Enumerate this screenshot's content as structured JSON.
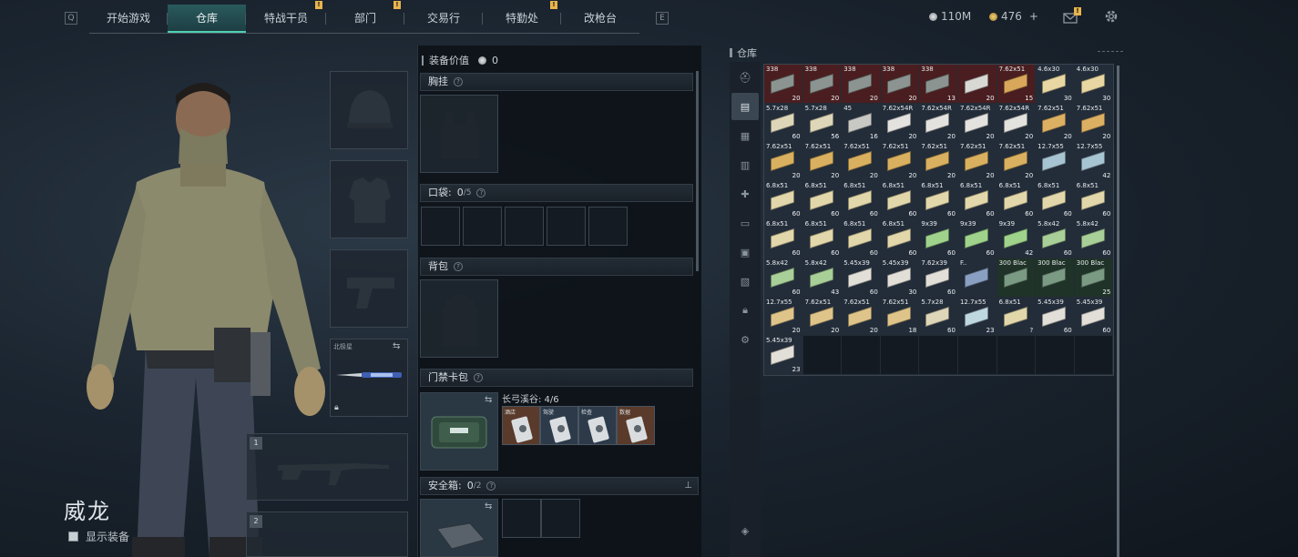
{
  "nav": {
    "left_key": "Q",
    "right_key": "E",
    "tabs": [
      {
        "label": "开始游戏",
        "badge": ""
      },
      {
        "label": "仓库",
        "badge": "",
        "active": true
      },
      {
        "label": "特战干员",
        "badge": "!"
      },
      {
        "label": "部门",
        "badge": "!"
      },
      {
        "label": "交易行",
        "badge": ""
      },
      {
        "label": "特勤处",
        "badge": "!"
      },
      {
        "label": "改枪台",
        "badge": ""
      }
    ],
    "silver": "110M",
    "gold": "476",
    "gold_plus": "+",
    "mail_badge": "!"
  },
  "character": {
    "name": "威龙",
    "show_equipment": "显示装备"
  },
  "slots": {
    "melee_label": "北极星",
    "weapon1_num": "1",
    "weapon2_num": "2"
  },
  "loadout": {
    "value_label": "装备价值",
    "value": "0",
    "chest_rig": "胸挂",
    "pockets_label": "口袋:",
    "pockets_used": "0",
    "pockets_total": "/5",
    "backpack": "背包",
    "keycard_label": "门禁卡包",
    "keycard_map": "长弓溪谷: 4/6",
    "keycards": [
      "酒店",
      "驾驶",
      "检查",
      "数据"
    ],
    "safebox_label": "安全箱:",
    "safebox_used": "0",
    "safebox_total": "/2"
  },
  "stash": {
    "title": "仓库",
    "items": [
      {
        "cal": "338",
        "n": "20",
        "c": "#8c9491",
        "bg": "red"
      },
      {
        "cal": "338",
        "n": "20",
        "c": "#8c9491",
        "bg": "red"
      },
      {
        "cal": "338",
        "n": "20",
        "c": "#8c9491",
        "bg": "red"
      },
      {
        "cal": "338",
        "n": "20",
        "c": "#8c9491",
        "bg": "red"
      },
      {
        "cal": "338",
        "n": "13",
        "c": "#8c9491",
        "bg": "red"
      },
      {
        "cal": "",
        "n": "20",
        "c": "#d8d8d4",
        "bg": "red"
      },
      {
        "cal": "7.62x51",
        "n": "15",
        "c": "#d9a75a",
        "bg": "red"
      },
      {
        "cal": "4.6x30",
        "n": "30",
        "c": "#e8d7a2",
        "bg": "it"
      },
      {
        "cal": "4.6x30",
        "n": "30",
        "c": "#e8d7a2",
        "bg": "it"
      },
      {
        "cal": "5.7x28",
        "n": "60",
        "c": "#ddd6b8",
        "bg": "it"
      },
      {
        "cal": "5.7x28",
        "n": "56",
        "c": "#ddd6b8",
        "bg": "it"
      },
      {
        "cal": "45",
        "n": "16",
        "c": "#c8c9c5",
        "bg": "it"
      },
      {
        "cal": "7.62x54R",
        "n": "20",
        "c": "#e3e2de",
        "bg": "it"
      },
      {
        "cal": "7.62x54R",
        "n": "20",
        "c": "#e3e2de",
        "bg": "it"
      },
      {
        "cal": "7.62x54R",
        "n": "20",
        "c": "#e3e2de",
        "bg": "it"
      },
      {
        "cal": "7.62x54R",
        "n": "20",
        "c": "#e3e2de",
        "bg": "it"
      },
      {
        "cal": "7.62x51",
        "n": "20",
        "c": "#dcb063",
        "bg": "it"
      },
      {
        "cal": "7.62x51",
        "n": "20",
        "c": "#dcb063",
        "bg": "it"
      },
      {
        "cal": "7.62x51",
        "n": "20",
        "c": "#d9b05f",
        "bg": "it"
      },
      {
        "cal": "7.62x51",
        "n": "20",
        "c": "#d9b05f",
        "bg": "it"
      },
      {
        "cal": "7.62x51",
        "n": "20",
        "c": "#d9b05f",
        "bg": "it"
      },
      {
        "cal": "7.62x51",
        "n": "20",
        "c": "#d9b05f",
        "bg": "it"
      },
      {
        "cal": "7.62x51",
        "n": "20",
        "c": "#d9b05f",
        "bg": "it"
      },
      {
        "cal": "7.62x51",
        "n": "20",
        "c": "#d9b05f",
        "bg": "it"
      },
      {
        "cal": "7.62x51",
        "n": "20",
        "c": "#d9b05f",
        "bg": "it"
      },
      {
        "cal": "12.7x55",
        "n": "",
        "c": "#a7c4d2",
        "bg": "it"
      },
      {
        "cal": "12.7x55",
        "n": "42",
        "c": "#a7c4d2",
        "bg": "it"
      },
      {
        "cal": "6.8x51",
        "n": "60",
        "c": "#e2d7aa",
        "bg": "it"
      },
      {
        "cal": "6.8x51",
        "n": "60",
        "c": "#e2d7aa",
        "bg": "it"
      },
      {
        "cal": "6.8x51",
        "n": "60",
        "c": "#e2d7aa",
        "bg": "it"
      },
      {
        "cal": "6.8x51",
        "n": "60",
        "c": "#e2d7aa",
        "bg": "it"
      },
      {
        "cal": "6.8x51",
        "n": "60",
        "c": "#e2d7aa",
        "bg": "it"
      },
      {
        "cal": "6.8x51",
        "n": "60",
        "c": "#e2d7aa",
        "bg": "it"
      },
      {
        "cal": "6.8x51",
        "n": "60",
        "c": "#e2d7aa",
        "bg": "it"
      },
      {
        "cal": "6.8x51",
        "n": "60",
        "c": "#e2d7aa",
        "bg": "it"
      },
      {
        "cal": "6.8x51",
        "n": "60",
        "c": "#e2d7aa",
        "bg": "it"
      },
      {
        "cal": "6.8x51",
        "n": "60",
        "c": "#e2d7aa",
        "bg": "it"
      },
      {
        "cal": "6.8x51",
        "n": "60",
        "c": "#e2d7aa",
        "bg": "it"
      },
      {
        "cal": "6.8x51",
        "n": "60",
        "c": "#e2d7aa",
        "bg": "it"
      },
      {
        "cal": "6.8x51",
        "n": "60",
        "c": "#e2d7aa",
        "bg": "it"
      },
      {
        "cal": "9x39",
        "n": "60",
        "c": "#9fd38c",
        "bg": "it"
      },
      {
        "cal": "9x39",
        "n": "60",
        "c": "#9fd38c",
        "bg": "it"
      },
      {
        "cal": "9x39",
        "n": "42",
        "c": "#9fd38c",
        "bg": "it"
      },
      {
        "cal": "5.8x42",
        "n": "60",
        "c": "#a9cf98",
        "bg": "it"
      },
      {
        "cal": "5.8x42",
        "n": "60",
        "c": "#a9cf98",
        "bg": "it"
      },
      {
        "cal": "5.8x42",
        "n": "60",
        "c": "#a9cf98",
        "bg": "it"
      },
      {
        "cal": "5.8x42",
        "n": "43",
        "c": "#a9cf98",
        "bg": "it"
      },
      {
        "cal": "5.45x39",
        "n": "60",
        "c": "#e2dfd8",
        "bg": "it"
      },
      {
        "cal": "5.45x39",
        "n": "30",
        "c": "#e2dfd8",
        "bg": "it"
      },
      {
        "cal": "7.62x39",
        "n": "60",
        "c": "#e2dfd8",
        "bg": "it"
      },
      {
        "cal": "F..",
        "n": "",
        "c": "#8aa0c2",
        "bg": "it"
      },
      {
        "cal": "300 Blac",
        "n": "",
        "c": "#7a9a84",
        "bg": "grn"
      },
      {
        "cal": "300 Blac",
        "n": "",
        "c": "#7a9a84",
        "bg": "grn"
      },
      {
        "cal": "300 Blac",
        "n": "25",
        "c": "#7a9a84",
        "bg": "grn"
      },
      {
        "cal": "12.7x55",
        "n": "20",
        "c": "#dfc48a",
        "bg": "it"
      },
      {
        "cal": "7.62x51",
        "n": "20",
        "c": "#dfc48a",
        "bg": "it"
      },
      {
        "cal": "7.62x51",
        "n": "20",
        "c": "#dfc48a",
        "bg": "it"
      },
      {
        "cal": "7.62x51",
        "n": "18",
        "c": "#dfc48a",
        "bg": "it"
      },
      {
        "cal": "5.7x28",
        "n": "60",
        "c": "#ddd6b8",
        "bg": "it"
      },
      {
        "cal": "12.7x55",
        "n": "23",
        "c": "#bfd8e0",
        "bg": "it"
      },
      {
        "cal": "6.8x51",
        "n": "?",
        "c": "#e2d7aa",
        "bg": "it"
      },
      {
        "cal": "5.45x39",
        "n": "60",
        "c": "#e2dfd8",
        "bg": "it"
      },
      {
        "cal": "5.45x39",
        "n": "60",
        "c": "#e2dfd8",
        "bg": "it"
      },
      {
        "cal": "5.45x39",
        "n": "23",
        "c": "#e2dfd8",
        "bg": "it"
      }
    ],
    "empty_cells": 8
  }
}
